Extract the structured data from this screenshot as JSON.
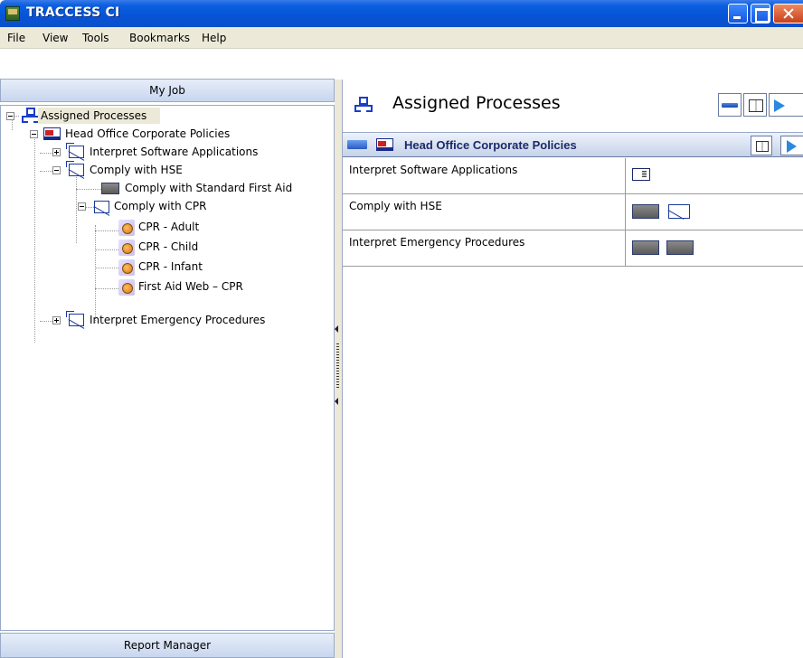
{
  "window": {
    "title": "TRACCESS CI"
  },
  "menu": [
    "File",
    "View",
    "Tools",
    "Bookmarks",
    "Help"
  ],
  "left_panel": {
    "header": "My Job",
    "footer": "Report Manager",
    "tree": {
      "root": "Assigned Processes",
      "policy": "Head Office Corporate Policies",
      "items": {
        "interpret_software": "Interpret Software Applications",
        "comply_hse": "Comply with HSE",
        "comply_first_aid": "Comply with Standard First Aid",
        "comply_cpr": "Comply with CPR",
        "cpr_adult": "CPR - Adult",
        "cpr_child": "CPR - Child",
        "cpr_infant": "CPR - Infant",
        "first_aid_web": "First Aid Web – CPR",
        "interpret_emergency": "Interpret Emergency Procedures"
      }
    }
  },
  "right_panel": {
    "title": "Assigned Processes",
    "section_title": "Head Office Corporate Policies",
    "rows": [
      {
        "name": "Interpret Software Applications",
        "status_icons": [
          "document-icon"
        ]
      },
      {
        "name": "Comply with HSE",
        "status_icons": [
          "filled-gray-icon",
          "process-outline-icon"
        ]
      },
      {
        "name": "Interpret Emergency Procedures",
        "status_icons": [
          "filled-gray-icon",
          "filled-gray-icon"
        ]
      }
    ]
  }
}
